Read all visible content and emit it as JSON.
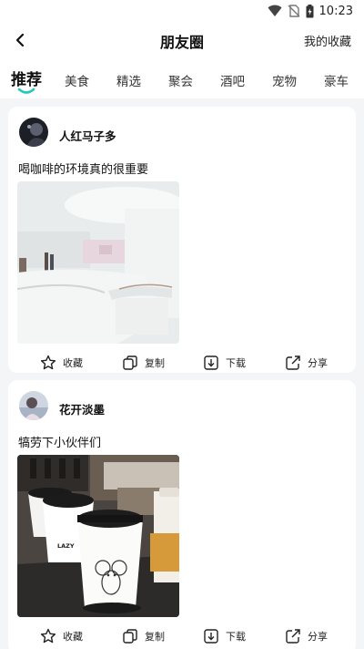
{
  "status": {
    "time": "10:23"
  },
  "header": {
    "title": "朋友圈",
    "favorites_link": "我的收藏"
  },
  "tabs": [
    {
      "label": "推荐",
      "active": true
    },
    {
      "label": "美食"
    },
    {
      "label": "精选"
    },
    {
      "label": "聚会"
    },
    {
      "label": "酒吧"
    },
    {
      "label": "宠物"
    },
    {
      "label": "豪车"
    }
  ],
  "accent_color": "#27c7c0",
  "posts": [
    {
      "username": "人红马子多",
      "caption": "喝咖啡的环境真的很重要",
      "image": "cafe-interior-photo"
    },
    {
      "username": "花开淡墨",
      "caption": "犒劳下小伙伴们",
      "image": "coffee-cups-photo",
      "image_text": "LAZY"
    }
  ],
  "actions": {
    "favorite": "收藏",
    "copy": "复制",
    "download": "下载",
    "share": "分享"
  }
}
